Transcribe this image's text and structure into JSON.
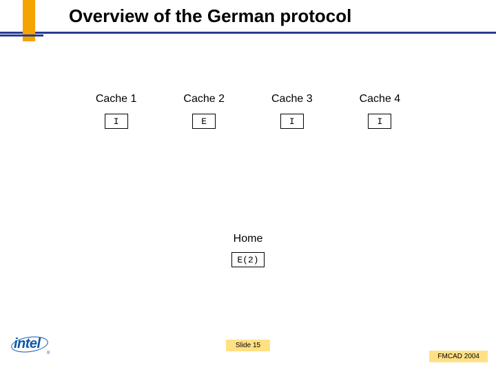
{
  "title": "Overview of the German protocol",
  "caches": [
    {
      "label": "Cache 1",
      "state": "I"
    },
    {
      "label": "Cache 2",
      "state": "E"
    },
    {
      "label": "Cache 3",
      "state": "I"
    },
    {
      "label": "Cache 4",
      "state": "I"
    }
  ],
  "home": {
    "label": "Home",
    "state": "E(2)"
  },
  "slide_number": "Slide 15",
  "footer": "FMCAD 2004",
  "logo": {
    "text": "intel",
    "reg": "®"
  },
  "colors": {
    "accent_orange": "#f5a300",
    "accent_blue": "#2a3a8f",
    "badge_bg": "#ffe084",
    "logo_blue": "#0a5aa6"
  }
}
